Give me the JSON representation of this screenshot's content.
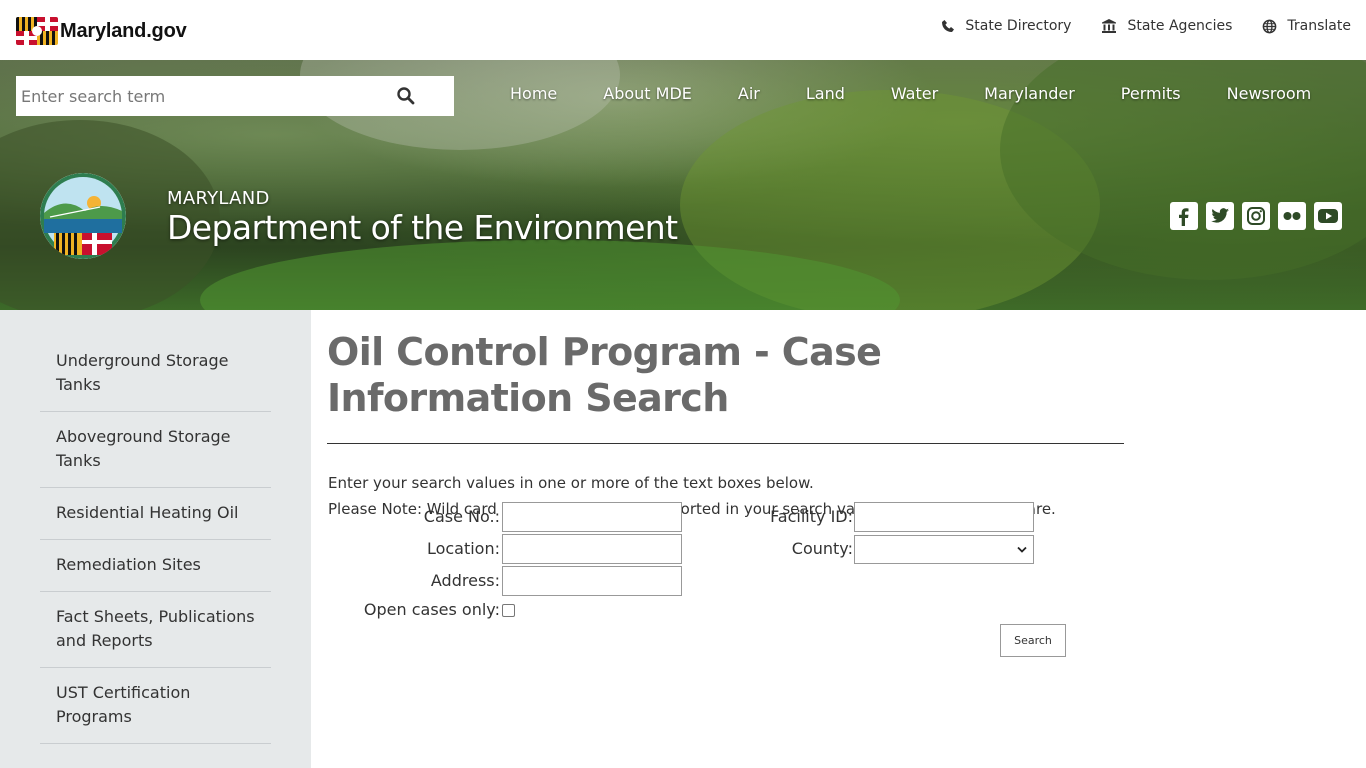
{
  "topbar": {
    "logo_text": "Maryland.gov",
    "links": [
      {
        "label": "State Directory",
        "icon": "phone-icon"
      },
      {
        "label": "State Agencies",
        "icon": "building-icon"
      },
      {
        "label": "Translate",
        "icon": "globe-icon"
      }
    ]
  },
  "search": {
    "placeholder": "Enter search term",
    "button_icon": "search-icon"
  },
  "nav": {
    "items": [
      "Home",
      "About MDE",
      "Air",
      "Land",
      "Water",
      "Marylander",
      "Permits",
      "Newsroom"
    ]
  },
  "agency": {
    "line1": "MARYLAND",
    "line2": "Department of the Environment"
  },
  "social": [
    "facebook-icon",
    "twitter-icon",
    "instagram-icon",
    "flickr-icon",
    "youtube-icon"
  ],
  "sidebar": {
    "items": [
      "Underground Storage Tanks",
      "Aboveground Storage Tanks",
      "Residential Heating Oil",
      "Remediation Sites",
      "Fact Sheets, Publications and Reports",
      "UST Certification Programs"
    ]
  },
  "main": {
    "title": "Oil Control Program - Case Information Search",
    "intro_line1": "Enter your search values in one or more of the text boxes below.",
    "intro_line2": "Please Note: Wild card characters are not supported in your search values but partial values are.",
    "form": {
      "case_no_label": "Case No.:",
      "case_no_value": "",
      "location_label": "Location:",
      "location_value": "",
      "address_label": "Address:",
      "address_value": "",
      "open_cases_label": "Open cases only:",
      "open_cases_checked": false,
      "facility_id_label": "Facility ID:",
      "facility_id_value": "",
      "county_label": "County:",
      "county_value": "",
      "search_button": "Search"
    }
  },
  "colors": {
    "sidebar_bg": "#e6e9ea",
    "title_gray": "#6a6a6a",
    "md_red": "#c8102e",
    "md_gold": "#f0b323"
  }
}
